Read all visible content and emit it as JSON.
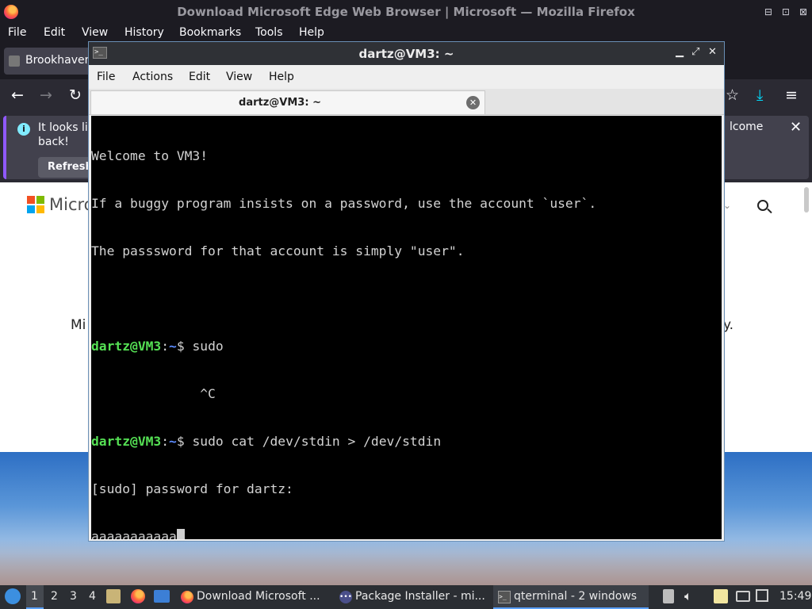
{
  "firefox": {
    "window_title": "Download Microsoft Edge Web Browser | Microsoft — Mozilla Firefox",
    "menu": [
      "File",
      "Edit",
      "View",
      "History",
      "Bookmarks",
      "Tools",
      "Help"
    ],
    "tab_label": "Brookhaven",
    "infobar": {
      "message": "It looks lik back!",
      "button": "Refresh",
      "welcome_fragment": "lcome"
    },
    "page": {
      "brand": "Micro",
      "body_fragment_left": "Mi",
      "body_fragment_right": "y."
    }
  },
  "terminal": {
    "window_title": "dartz@VM3: ~",
    "menu": [
      "File",
      "Actions",
      "Edit",
      "View",
      "Help"
    ],
    "tab_label": "dartz@VM3: ~",
    "prompt_user": "dartz@VM3",
    "prompt_path": "~",
    "output": {
      "welcome_1": "Welcome to VM3!",
      "welcome_2": "If a buggy program insists on a password, use the account `user`.",
      "welcome_3": "The passsword for that account is simply \"user\".",
      "cmd_1": "sudo",
      "interrupt": "              ^C",
      "cmd_2": "sudo cat /dev/stdin > /dev/stdin",
      "sudo_prompt": "[sudo] password for dartz:",
      "typed": "aaaaaaaaaaa"
    }
  },
  "taskbar": {
    "workspaces": [
      "1",
      "2",
      "3",
      "4"
    ],
    "tasks": [
      {
        "label": "Download Microsoft ..."
      },
      {
        "label": "Package Installer - mi..."
      },
      {
        "label": "qterminal - 2 windows"
      }
    ],
    "clock": "15:49"
  }
}
